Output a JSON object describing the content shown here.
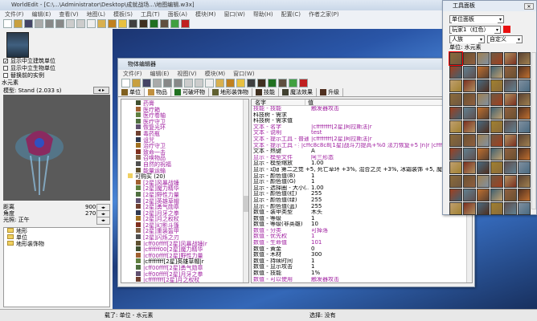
{
  "window": {
    "title": "WorldEdit - [C:\\...\\Administrator\\Desktop\\成就战场...\\地图编辑.w3x]"
  },
  "menu": [
    "文件(F)",
    "编辑(E)",
    "查看(V)",
    "地图(L)",
    "模板(S)",
    "工具(T)",
    "面板(A)",
    "模块(M)",
    "窗口(W)",
    "帮助(H)",
    "配置(C)",
    "作者之家(P)"
  ],
  "left_panel": {
    "checkboxes": [
      {
        "label": "显示中立建筑单位",
        "checked": true
      },
      {
        "label": "显示中立生物单位",
        "checked": false
      },
      {
        "label": "替换前的实例",
        "checked": false
      }
    ],
    "unit_name": "水元素",
    "model_label": "模型: Stand (2.033 s)",
    "fields": [
      {
        "label": "距离",
        "value": "900"
      },
      {
        "label": "角度",
        "value": "270"
      },
      {
        "label": "光照: 正午",
        "value": ""
      }
    ],
    "tree": [
      "地形",
      "单位",
      "地形装饰物"
    ]
  },
  "object_editor": {
    "title": "物体编辑器",
    "menu": [
      "文件(F)",
      "编辑(E)",
      "视图(V)",
      "模块(M)",
      "窗口(W)"
    ],
    "tabs": [
      "单位",
      "物品",
      "可破坏物",
      "地形装饰物",
      "技能",
      "魔法效果",
      "升级"
    ],
    "tree": [
      {
        "label": "药膏",
        "p": true
      },
      {
        "label": "医疗箱",
        "p": true
      },
      {
        "label": "医疗卷轴",
        "p": true
      },
      {
        "label": "医疗守卫",
        "p": true
      },
      {
        "label": "恢复光环",
        "p": true
      },
      {
        "label": "毒药瓶",
        "p": true
      },
      {
        "label": "诅咒",
        "p": true
      },
      {
        "label": "治疗守卫",
        "p": true
      },
      {
        "label": "致命一击",
        "p": true
      },
      {
        "label": "召唤物品",
        "p": true
      },
      {
        "label": "自然的祝福",
        "p": true
      },
      {
        "label": "能量运输",
        "p": true
      },
      {
        "label": "可购买 (20)",
        "p": false,
        "folder": true
      },
      {
        "label": "[2星]风暴战锤",
        "p": true
      },
      {
        "label": "[2星]魔力精华",
        "p": true
      },
      {
        "label": "[2星]野性力量",
        "p": true
      },
      {
        "label": "[2星]英雄草帽",
        "p": true
      },
      {
        "label": "[2星]勇气勋章",
        "p": true
      },
      {
        "label": "[2星]月牙之拳",
        "p": true
      },
      {
        "label": "[2星]月之权杖",
        "p": true
      },
      {
        "label": "[2星]幻影斗篷",
        "p": true
      },
      {
        "label": "[2星]重装盔甲",
        "p": true
      },
      {
        "label": "[2星]闪烁之刃",
        "p": true
      },
      {
        "label": "|cff00ffff[2星]风暴战锤|r",
        "p": true
      },
      {
        "label": "|cffffff00[2星]魔力精华",
        "p": true
      },
      {
        "label": "|cff00ffff[2星]野性力量",
        "p": true
      },
      {
        "label": "|cffffffff[2星]英雄草帽|r",
        "p": false
      },
      {
        "label": "|cff00ffff[2星]勇气勋章",
        "p": true
      },
      {
        "label": "|cff00ffff[2星]月牙之拳",
        "p": true
      },
      {
        "label": "|cffffffff[2星]月之权杖",
        "p": true
      }
    ],
    "table_headers": [
      "名字",
      "值"
    ],
    "rows": [
      [
        "技能 - 技能",
        "触发器攻击",
        true
      ],
      [
        "科技树 - 需求",
        "",
        false
      ],
      [
        "科技树 - 需求值",
        "",
        false
      ],
      [
        "文本 - 名字",
        "|cffffffff[2星]阿拉斯法|r",
        true
      ],
      [
        "文本 - 说明",
        "test",
        true
      ],
      [
        "文本 - 提示工具 - 普通",
        "|cffffffff[2星]阿拉斯法|r",
        true
      ],
      [
        "文本 - 提示工具 - 扩展",
        "|cffc8c8c8[1星]战斗力提高+%0 法力恢复+5 |n|r |cffffff00[2星...",
        true
      ],
      [
        "文本 - 热键",
        "A",
        false
      ],
      [
        "显示 - 模型文件",
        "阿三形态",
        true
      ],
      [
        "显示 - 模型缩放",
        "1.00",
        false
      ],
      [
        "显示 - 动画名",
        "第二之觉 +5, 死亡草环 +3%, 混合之灵 +3%, 冰霜装饰 +5, 魔法之靴, C...",
        false
      ],
      [
        "显示 - 颜色值(B)",
        "1",
        false
      ],
      [
        "显示 - 颜色值(G)",
        "1",
        false
      ],
      [
        "显示 - 选择圈 - 大小(...",
        "1.00",
        false
      ],
      [
        "显示 - 颜色值(红)",
        "255",
        false
      ],
      [
        "显示 - 颜色值(绿)",
        "255",
        false
      ],
      [
        "显示 - 颜色值(蓝)",
        "255",
        false
      ],
      [
        "数值 - 装甲类型",
        "木头",
        false
      ],
      [
        "数值 - 等级",
        "1",
        false
      ],
      [
        "数值 - 等级(非英雄)",
        "10",
        false
      ],
      [
        "数值 - 分类",
        "可掉落",
        true
      ],
      [
        "数值 - 优先权",
        "1",
        true
      ],
      [
        "数值 - 生命值",
        "101",
        true
      ],
      [
        "数值 - 黄金",
        "0",
        false
      ],
      [
        "数值 - 木材",
        "300",
        false
      ],
      [
        "数值 - 持续时间",
        "1",
        false
      ],
      [
        "数值 - 显示攻击",
        "1",
        false
      ],
      [
        "数值 - 技能",
        "1%",
        false
      ],
      [
        "数值 - 可以使用",
        "触发器攻击",
        true
      ],
      [
        "数值 - 死亡时掉落",
        "FALSE",
        false
      ],
      [
        "数值 - 可被抵押",
        "FALSE",
        false
      ],
      [
        "数值 - 不可被他人拾取",
        "FALSE",
        false
      ],
      [
        "数值 - 拾取时自动使用",
        "FALSE",
        false
      ],
      [
        "数值 - 可被市场出售",
        "FALSE",
        true
      ],
      [
        "数值 - 可以被丢弃",
        "FALSE",
        true
      ]
    ]
  },
  "palette": {
    "title": "工具面板",
    "mode": "单位面板",
    "player": "玩家1（红色）",
    "player_color": "#e81010",
    "race": "人族",
    "category": "自定义",
    "unit_label": "单位: 水元素"
  },
  "status": {
    "loaded": "载了: 单位 - 水元素",
    "selection": "选择: 没有"
  }
}
